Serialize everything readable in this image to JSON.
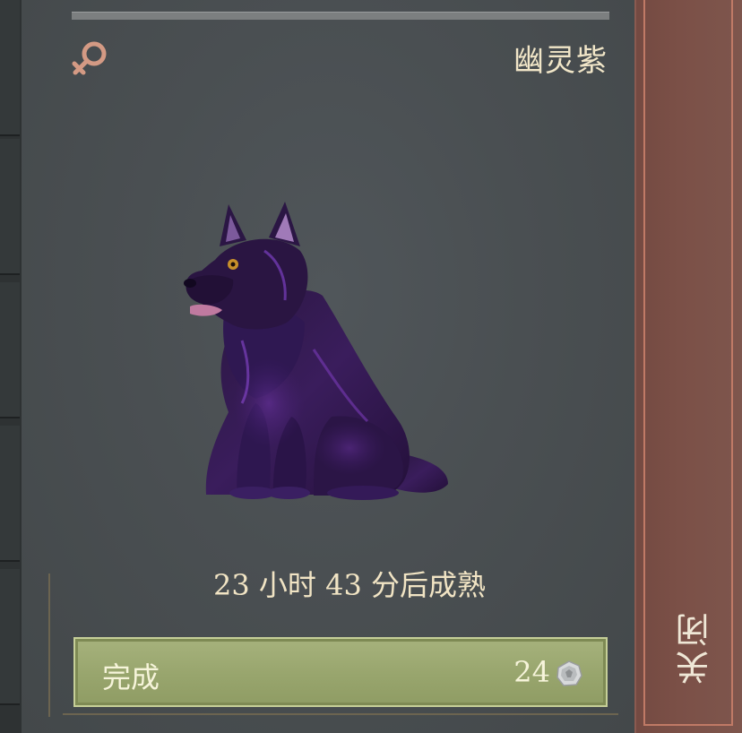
{
  "pet": {
    "variant_name": "幽灵紫",
    "gender_icon": "female-symbol-icon",
    "image_icon": "purple-ghost-dog-icon"
  },
  "growth": {
    "timer_text": "23 小时 43 分后成熟"
  },
  "finish_button": {
    "label": "完成",
    "cost": "24",
    "currency_icon": "silver-coin-icon"
  },
  "close_button": {
    "label": "关闭"
  },
  "colors": {
    "panel_bg": "#4a4f52",
    "finish_button_bg": "#98a56d",
    "close_bar_bg": "#7b5047",
    "text_cream": "#f1e4c4",
    "gender_icon": "#d49a84"
  }
}
